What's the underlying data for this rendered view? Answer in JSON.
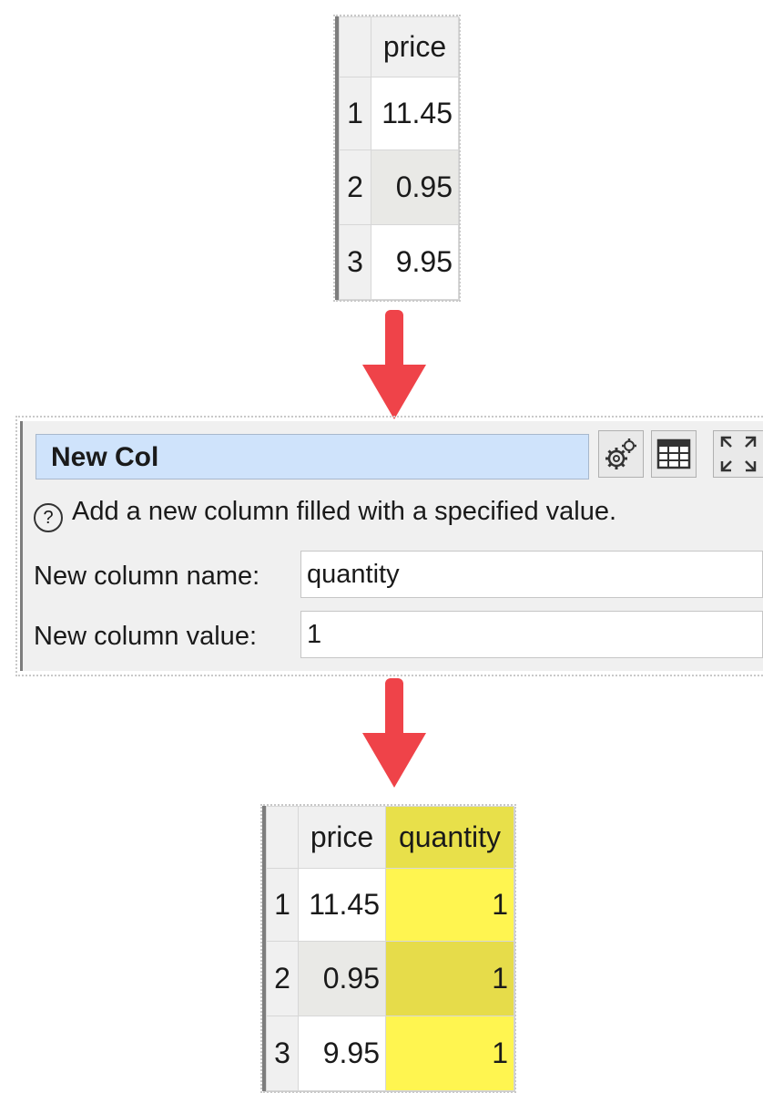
{
  "input_table": {
    "header": "price",
    "rows": [
      {
        "n": "1",
        "price": "11.45"
      },
      {
        "n": "2",
        "price": "0.95"
      },
      {
        "n": "3",
        "price": "9.95"
      }
    ]
  },
  "panel": {
    "title": "New Col",
    "description": "Add a new column filled with a specified value.",
    "name_label": "New column name:",
    "name_value": "quantity",
    "value_label": "New column value:",
    "value_value": "1",
    "buttons": [
      "gears-icon",
      "table-icon",
      "maximize-icon"
    ]
  },
  "output_table": {
    "headers": [
      "price",
      "quantity"
    ],
    "rows": [
      {
        "n": "1",
        "price": "11.45",
        "quantity": "1"
      },
      {
        "n": "2",
        "price": "0.95",
        "quantity": "1"
      },
      {
        "n": "3",
        "price": "9.95",
        "quantity": "1"
      }
    ]
  },
  "colors": {
    "arrow": "#ef4349",
    "new_column": "#fff550",
    "title_bar": "#cfe3fb"
  }
}
